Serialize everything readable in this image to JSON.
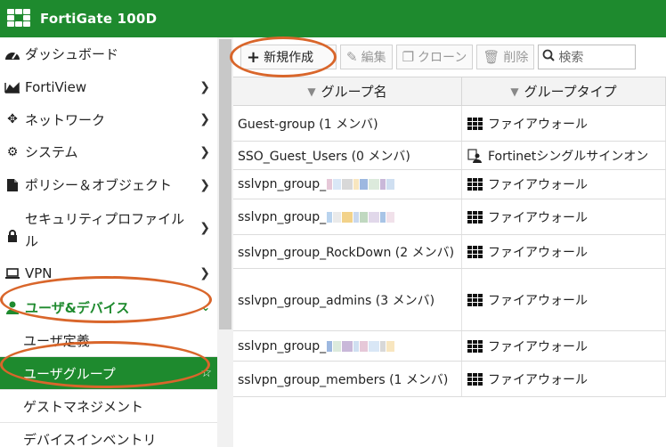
{
  "app": {
    "title": "FortiGate 100D"
  },
  "sidebar": {
    "items": [
      {
        "label": "ダッシュボード",
        "icon": "dashboard-icon",
        "chevron": false
      },
      {
        "label": "FortiView",
        "icon": "chart-icon",
        "chevron": true
      },
      {
        "label": "ネットワーク",
        "icon": "network-icon",
        "chevron": true
      },
      {
        "label": "システム",
        "icon": "gear-icon",
        "chevron": true
      },
      {
        "label": "ポリシー＆オブジェクト",
        "icon": "policy-icon",
        "chevron": true
      },
      {
        "label": "セキュリティプロファイル",
        "label2": "ル",
        "icon": "lock-icon",
        "chevron": true
      },
      {
        "label": "VPN",
        "icon": "laptop-icon",
        "chevron": true
      },
      {
        "label": "ユーザ&デバイス",
        "icon": "user-icon",
        "chevron": true,
        "active": true
      }
    ],
    "subitems": [
      {
        "label": "ユーザ定義"
      },
      {
        "label": "ユーザグループ",
        "selected": true
      },
      {
        "label": "ゲストマネジメント"
      },
      {
        "label": "デバイスインベントリ"
      }
    ]
  },
  "toolbar": {
    "new_label": "新規作成",
    "edit_label": "編集",
    "clone_label": "クローン",
    "delete_label": "削除",
    "search_placeholder": "検索"
  },
  "table": {
    "columns": [
      "グループ名",
      "グループタイプ"
    ],
    "rows": [
      {
        "name": "Guest-group (1 メンバ)",
        "type": "ファイアウォール",
        "type_icon": "firewall-icon"
      },
      {
        "name": "SSO_Guest_Users (0 メンバ)",
        "type": "Fortinetシングルサインオン",
        "type_icon": "sso-icon"
      },
      {
        "name": "sslvpn_group_",
        "type": "ファイアウォール",
        "type_icon": "firewall-icon",
        "redacted": true
      },
      {
        "name": "sslvpn_group_",
        "type": "ファイアウォール",
        "type_icon": "firewall-icon",
        "redacted": true
      },
      {
        "name": "sslvpn_group_RockDown (2 メンバ)",
        "type": "ファイアウォール",
        "type_icon": "firewall-icon"
      },
      {
        "name": "sslvpn_group_admins (3 メンバ)",
        "type": "ファイアウォール",
        "type_icon": "firewall-icon"
      },
      {
        "name": "sslvpn_group_",
        "type": "ファイアウォール",
        "type_icon": "firewall-icon",
        "redacted": true
      },
      {
        "name": "sslvpn_group_members (1 メンバ)",
        "type": "ファイアウォール",
        "type_icon": "firewall-icon"
      }
    ]
  },
  "colors": {
    "brand": "#1e8a2e",
    "annotation": "#d9662b"
  }
}
